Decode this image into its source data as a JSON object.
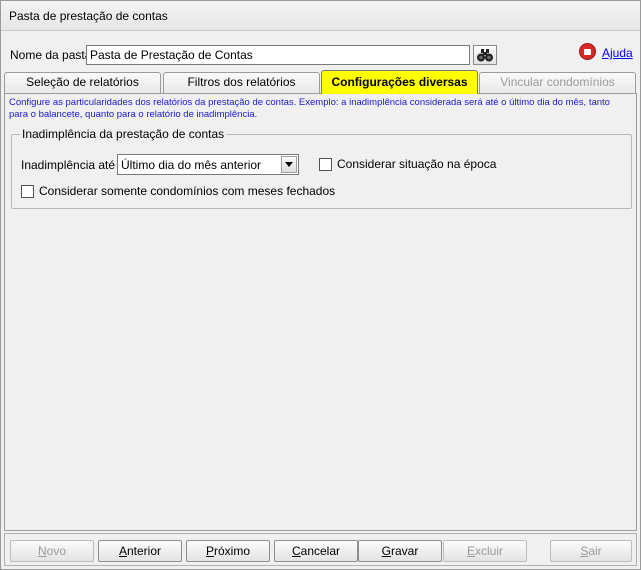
{
  "window": {
    "title": "Pasta de prestação de contas"
  },
  "header": {
    "name_label": "Nome da pasta:",
    "name_value": "Pasta de Prestação de Contas",
    "help_label": "Ajuda"
  },
  "tabs": [
    {
      "label": "Seleção de relatórios",
      "state": "normal"
    },
    {
      "label": "Filtros dos relatórios",
      "state": "normal"
    },
    {
      "label": "Configurações diversas",
      "state": "active"
    },
    {
      "label": "Vincular condomínios",
      "state": "disabled"
    }
  ],
  "panel": {
    "description": "Configure as particularidades dos relatórios da prestação de contas. Exemplo: a inadimplência considerada será até o último dia do mês, tanto para o balancete, quanto para o relatório de inadimplência.",
    "group_title": "Inadimplência da prestação de contas",
    "inad_label": "Inadimplência até",
    "inad_selected": "Último dia do mês anterior",
    "chk_epoca": {
      "label": "Considerar situação na época",
      "checked": false
    },
    "chk_fechados": {
      "label": "Considerar somente condomínios com meses fechados",
      "checked": false
    }
  },
  "buttons": {
    "novo": {
      "first": "N",
      "rest": "ovo",
      "enabled": false
    },
    "anterior": {
      "first": "A",
      "rest": "nterior",
      "enabled": true
    },
    "proximo": {
      "first": "P",
      "rest": "róximo",
      "enabled": true
    },
    "cancelar": {
      "first": "C",
      "rest": "ancelar",
      "enabled": true
    },
    "gravar": {
      "first": "G",
      "rest": "ravar",
      "enabled": true
    },
    "excluir": {
      "first": "E",
      "rest": "xcluir",
      "enabled": false
    },
    "sair": {
      "first": "S",
      "rest": "air",
      "enabled": false
    }
  },
  "colors": {
    "active_tab": "#ffff00",
    "description_text": "#1a1ad0",
    "help_icon": "#d62828",
    "link": "#0000ee"
  },
  "icons": {
    "search": "binoculars-icon",
    "help": "help-record-icon",
    "dropdown": "chevron-down-icon"
  }
}
